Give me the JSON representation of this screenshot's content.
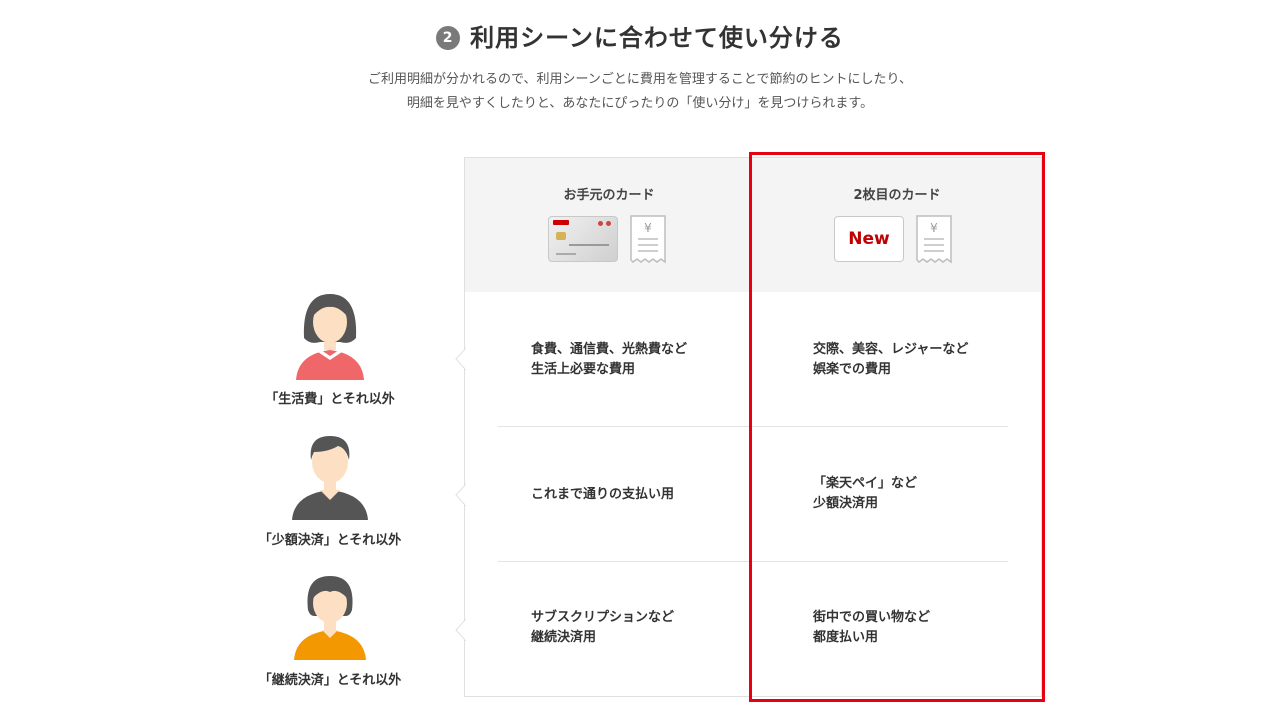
{
  "header": {
    "step_number": "2",
    "title": "利用シーンに合わせて使い分ける",
    "description_line1": "ご利用明細が分かれるので、利用シーンごとに費用を管理することで節約のヒントにしたり、",
    "description_line2": "明細を見やすくしたりと、あなたにぴったりの「使い分け」を見つけられます。"
  },
  "columns": {
    "current_card": {
      "title": "お手元のカード",
      "receipt_symbol": "¥"
    },
    "second_card": {
      "title": "2枚目のカード",
      "badge": "New",
      "receipt_symbol": "¥"
    }
  },
  "rows": [
    {
      "person_label": "「生活費」とそれ以外",
      "current_line1": "食費、通信費、光熱費など",
      "current_line2": "生活上必要な費用",
      "second_line1": "交際、美容、レジャーなど",
      "second_line2": "娯楽での費用",
      "avatar_color": "#f0676a"
    },
    {
      "person_label": "「少額決済」とそれ以外",
      "current_line1": "これまで通りの支払い用",
      "second_line1": "「楽天ペイ」など",
      "second_line2": "少額決済用",
      "avatar_color": "#555555"
    },
    {
      "person_label": "「継続決済」とそれ以外",
      "current_line1": "サブスクリプションなど",
      "current_line2": "継続決済用",
      "second_line1": "街中での買い物など",
      "second_line2": "都度払い用",
      "avatar_color": "#f39800"
    }
  ],
  "colors": {
    "highlight": "#e60012",
    "badge_text": "#bf0000",
    "header_bg": "#f4f4f4"
  },
  "icons": [
    "credit-card-icon",
    "receipt-icon",
    "new-badge",
    "woman-avatar-icon",
    "man-avatar-icon",
    "person-avatar-icon"
  ]
}
